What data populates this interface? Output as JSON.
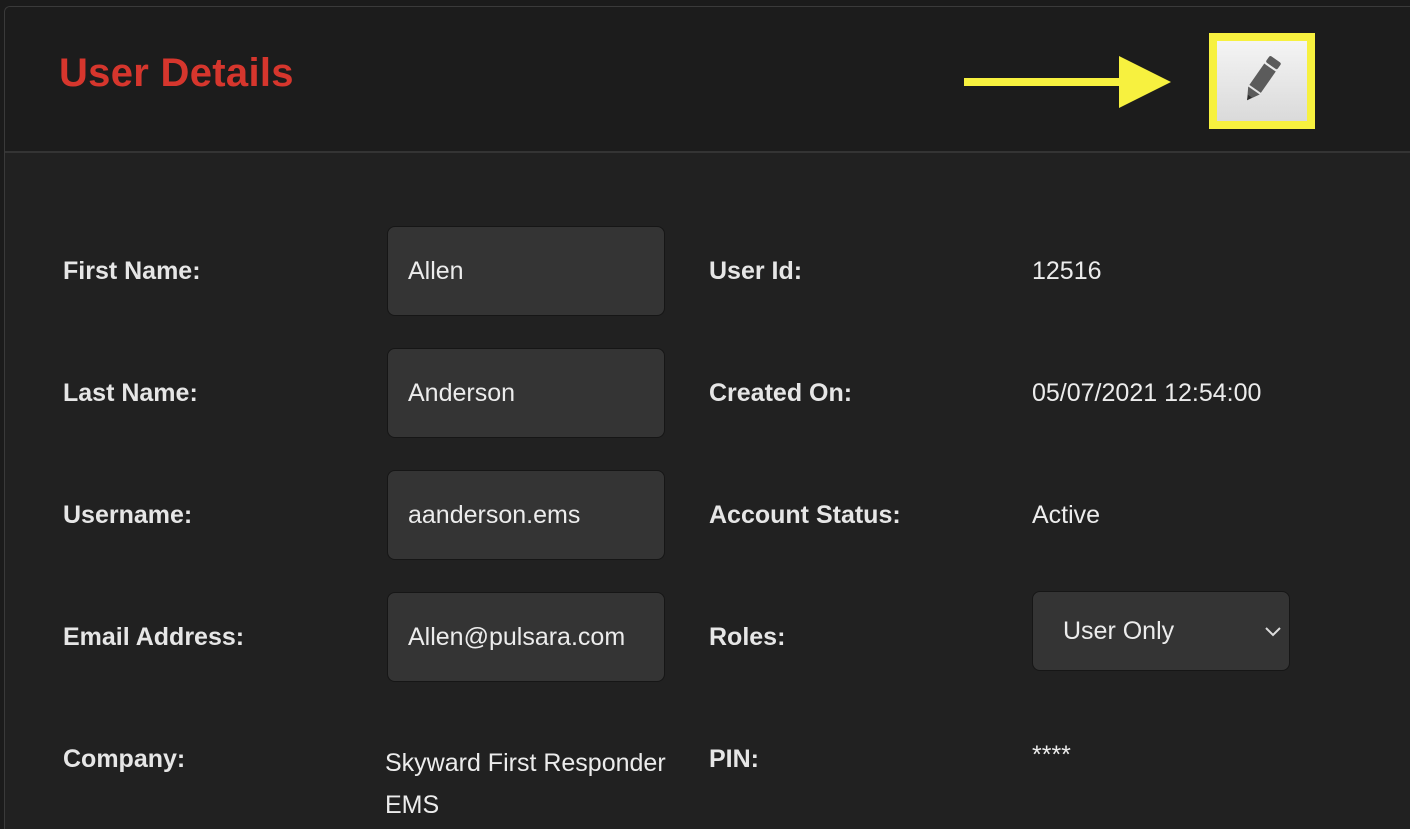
{
  "header": {
    "title": "User Details",
    "edit_icon": "pencil-icon"
  },
  "annotation": {
    "color": "#f7f13f"
  },
  "colors": {
    "title": "#d6362d",
    "panel": "#212121",
    "field": "#343434"
  },
  "form": {
    "first_name": {
      "label": "First Name:",
      "value": "Allen"
    },
    "last_name": {
      "label": "Last Name:",
      "value": "Anderson"
    },
    "username": {
      "label": "Username:",
      "value": "aanderson.ems"
    },
    "email": {
      "label": "Email Address:",
      "value": "Allen@pulsara.com"
    },
    "company": {
      "label": "Company:",
      "value": "Skyward First Responder EMS"
    }
  },
  "details": {
    "user_id": {
      "label": "User Id:",
      "value": "12516"
    },
    "created_on": {
      "label": "Created On:",
      "value": "05/07/2021 12:54:00"
    },
    "account_status": {
      "label": "Account Status:",
      "value": "Active"
    },
    "roles": {
      "label": "Roles:",
      "value": "User Only",
      "icon": "chevron-down-icon"
    },
    "pin": {
      "label": "PIN:",
      "value": "****"
    }
  }
}
